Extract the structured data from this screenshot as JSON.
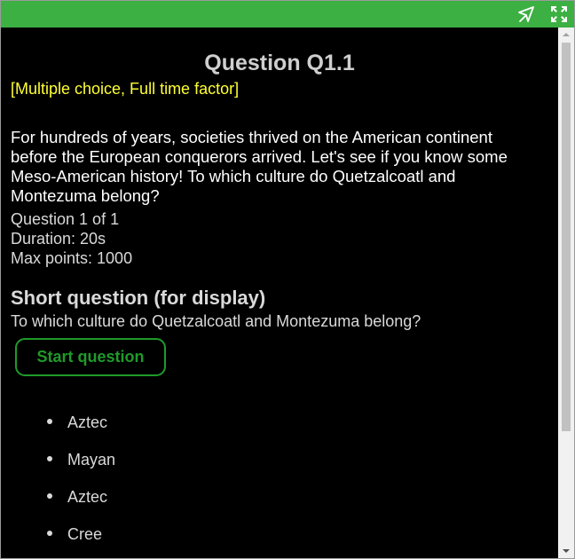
{
  "toolbar": {
    "pin_icon": "pin-icon",
    "expand_icon": "expand-icon",
    "bar_color": "#3cb043"
  },
  "question": {
    "title": "Question Q1.1",
    "type_label": "[Multiple choice, Full time factor]",
    "text": "For hundreds of years, societies thrived on the American continent before the European conquerors arrived. Let's see if you know some Meso-American history! To which culture do Quetzalcoatl and Montezuma belong?",
    "position": "Question 1 of 1",
    "duration": "Duration: 20s",
    "max_points": "Max points: 1000"
  },
  "short_question": {
    "heading": "Short question (for display)",
    "text": "To which culture do Quetzalcoatl and Montezuma belong?"
  },
  "start_button": {
    "label": "Start question",
    "color": "#1f9a2a"
  },
  "answers": [
    "Aztec",
    "Mayan",
    "Aztec",
    "Cree"
  ],
  "colors": {
    "background": "#000000",
    "type_label": "#ffff33"
  }
}
